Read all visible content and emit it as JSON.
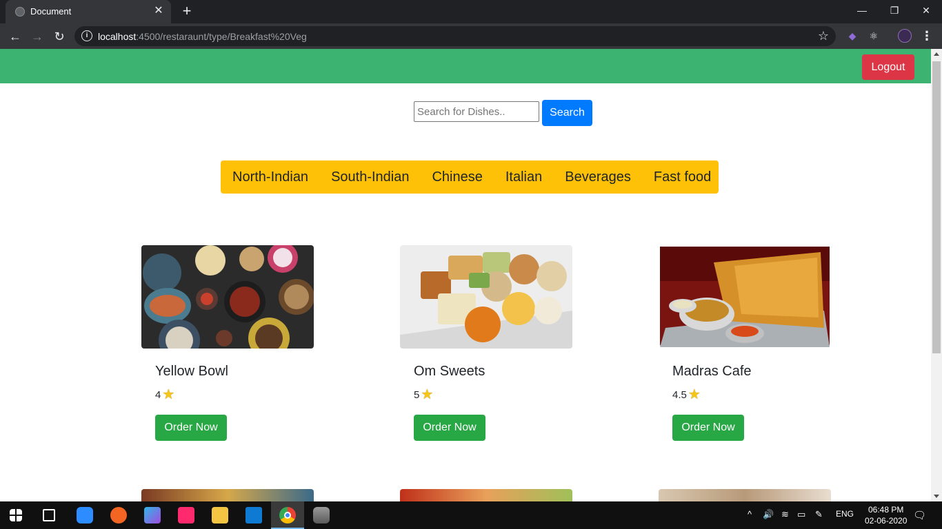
{
  "browser": {
    "tab_title": "Document",
    "tab_close": "✕",
    "new_tab": "+",
    "url_host": "localhost",
    "url_path": ":4500/restaraunt/type/Breakfast%20Veg",
    "window_controls": {
      "minimize": "—",
      "restore": "❐",
      "close": "✕"
    }
  },
  "app": {
    "logout_label": "Logout",
    "search_placeholder": "Search for Dishes..",
    "search_label": "Search",
    "categories": [
      "North-Indian",
      "South-Indian",
      "Chinese",
      "Italian",
      "Beverages",
      "Fast food"
    ]
  },
  "restaurants": [
    {
      "name": "Yellow Bowl",
      "rating": "4",
      "order_label": "Order Now"
    },
    {
      "name": "Om Sweets",
      "rating": "5",
      "order_label": "Order Now"
    },
    {
      "name": "Madras Cafe",
      "rating": "4.5",
      "order_label": "Order Now"
    }
  ],
  "taskbar": {
    "language": "ENG",
    "time": "06:48 PM",
    "date": "02-06-2020"
  },
  "colors": {
    "navbar": "#3cb371",
    "logout": "#dc3545",
    "search": "#007bff",
    "category_bar": "#ffc107",
    "order": "#28a745"
  },
  "icons": [
    "globe-icon",
    "back-icon",
    "forward-icon",
    "reload-icon",
    "info-icon",
    "bookmark-star-icon",
    "star-rating-icon",
    "windows-start-icon"
  ]
}
